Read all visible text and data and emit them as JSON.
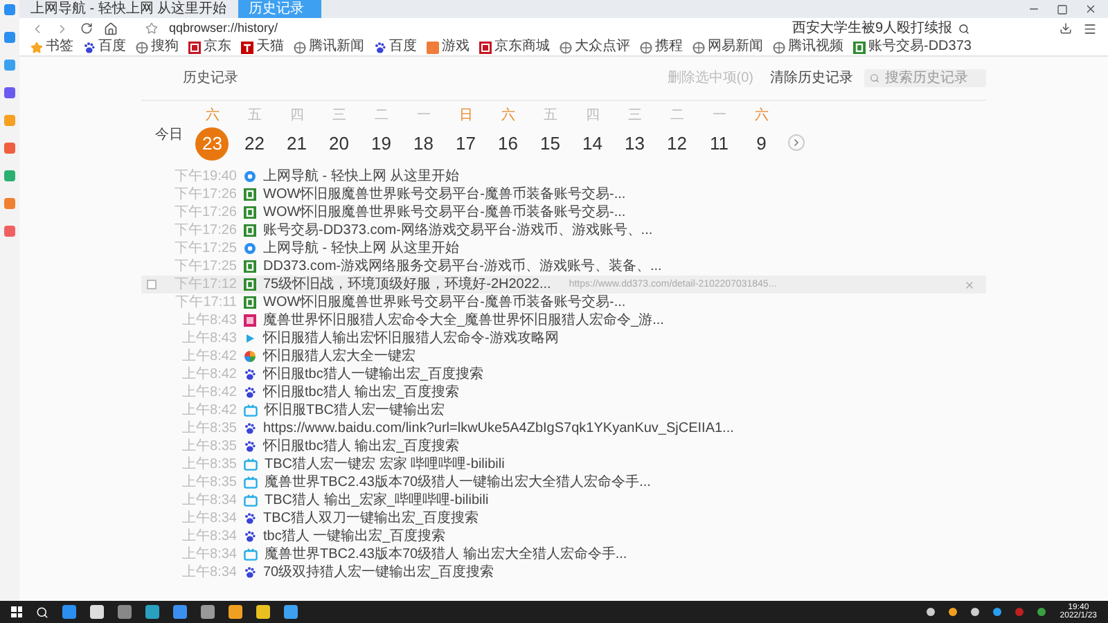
{
  "tabs": [
    {
      "title": "上网导航 - 轻快上网 从这里开始",
      "selected": false
    },
    {
      "title": "历史记录",
      "selected": true
    }
  ],
  "address": "qqbrowser://history/",
  "toolbar_search": "西安大学生被9人殴打续报",
  "bookmarks": [
    {
      "label": "书签",
      "kind": "star"
    },
    {
      "label": "百度",
      "kind": "paw"
    },
    {
      "label": "搜狗",
      "kind": "globe"
    },
    {
      "label": "京东",
      "kind": "jd"
    },
    {
      "label": "天猫",
      "kind": "tmall"
    },
    {
      "label": "腾讯新闻",
      "kind": "globe"
    },
    {
      "label": "百度",
      "kind": "paw"
    },
    {
      "label": "游戏",
      "kind": "game"
    },
    {
      "label": "京东商城",
      "kind": "jd"
    },
    {
      "label": "大众点评",
      "kind": "globe"
    },
    {
      "label": "携程",
      "kind": "globe"
    },
    {
      "label": "网易新闻",
      "kind": "globe"
    },
    {
      "label": "腾讯视频",
      "kind": "globe"
    },
    {
      "label": "账号交易-DD373",
      "kind": "d"
    }
  ],
  "header": {
    "title": "历史记录",
    "delete": "删除选中项(0)",
    "clear": "清除历史记录",
    "search_placeholder": "搜索历史记录"
  },
  "dates": {
    "today": "今日",
    "days": [
      {
        "weekday": "六",
        "day": "23",
        "weekend": true,
        "selected": true
      },
      {
        "weekday": "五",
        "day": "22",
        "weekend": false,
        "selected": false
      },
      {
        "weekday": "四",
        "day": "21",
        "weekend": false,
        "selected": false
      },
      {
        "weekday": "三",
        "day": "20",
        "weekend": false,
        "selected": false
      },
      {
        "weekday": "二",
        "day": "19",
        "weekend": false,
        "selected": false
      },
      {
        "weekday": "一",
        "day": "18",
        "weekend": false,
        "selected": false
      },
      {
        "weekday": "日",
        "day": "17",
        "weekend": true,
        "selected": false
      },
      {
        "weekday": "六",
        "day": "16",
        "weekend": true,
        "selected": false
      },
      {
        "weekday": "五",
        "day": "15",
        "weekend": false,
        "selected": false
      },
      {
        "weekday": "四",
        "day": "14",
        "weekend": false,
        "selected": false
      },
      {
        "weekday": "三",
        "day": "13",
        "weekend": false,
        "selected": false
      },
      {
        "weekday": "二",
        "day": "12",
        "weekend": false,
        "selected": false
      },
      {
        "weekday": "一",
        "day": "11",
        "weekend": false,
        "selected": false
      },
      {
        "weekday": "六",
        "day": "9",
        "weekend": true,
        "selected": false
      }
    ]
  },
  "history": [
    {
      "time": "下午19:40",
      "title": "上网导航 - 轻快上网 从这里开始",
      "kind": "ie",
      "hovered": false
    },
    {
      "time": "下午17:26",
      "title": "WOW怀旧服魔兽世界账号交易平台-魔兽币装备账号交易-...",
      "kind": "d",
      "hovered": false
    },
    {
      "time": "下午17:26",
      "title": "WOW怀旧服魔兽世界账号交易平台-魔兽币装备账号交易-...",
      "kind": "d",
      "hovered": false
    },
    {
      "time": "下午17:26",
      "title": "账号交易-DD373.com-网络游戏交易平台-游戏币、游戏账号、...",
      "kind": "d",
      "hovered": false
    },
    {
      "time": "下午17:25",
      "title": "上网导航 - 轻快上网 从这里开始",
      "kind": "ie",
      "hovered": false
    },
    {
      "time": "下午17:25",
      "title": "DD373.com-游戏网络服务交易平台-游戏币、游戏账号、装备、...",
      "kind": "d",
      "hovered": false
    },
    {
      "time": "下午17:12",
      "title": "75级怀旧战，环境顶级好服，环境好-2H2022...",
      "kind": "d",
      "hovered": true,
      "url": "https://www.dd373.com/detail-2102207031845..."
    },
    {
      "time": "下午17:11",
      "title": "WOW怀旧服魔兽世界账号交易平台-魔兽币装备账号交易-...",
      "kind": "d",
      "hovered": false
    },
    {
      "time": "上午8:43",
      "title": "魔兽世界怀旧服猎人宏命令大全_魔兽世界怀旧服猎人宏命令_游...",
      "kind": "ten",
      "hovered": false
    },
    {
      "time": "上午8:43",
      "title": "怀旧服猎人输出宏怀旧服猎人宏命令-游戏攻略网",
      "kind": "arrow",
      "hovered": false
    },
    {
      "time": "上午8:42",
      "title": "怀旧服猎人宏大全一键宏",
      "kind": "multi",
      "hovered": false
    },
    {
      "time": "上午8:42",
      "title": "怀旧服tbc猎人一键输出宏_百度搜索",
      "kind": "baidu",
      "hovered": false
    },
    {
      "time": "上午8:42",
      "title": "怀旧服tbc猎人 输出宏_百度搜索",
      "kind": "baidu",
      "hovered": false
    },
    {
      "time": "上午8:42",
      "title": "怀旧服TBC猎人宏一键输出宏",
      "kind": "bili",
      "hovered": false
    },
    {
      "time": "上午8:35",
      "title": "https://www.baidu.com/link?url=lkwUke5A4ZbIgS7qk1YKyanKuv_SjCEIIA1...",
      "kind": "baidu",
      "hovered": false
    },
    {
      "time": "上午8:35",
      "title": "怀旧服tbc猎人 输出宏_百度搜索",
      "kind": "baidu",
      "hovered": false
    },
    {
      "time": "上午8:35",
      "title": "TBC猎人宏一键宏 宏家 哔哩哔哩-bilibili",
      "kind": "bili",
      "hovered": false
    },
    {
      "time": "上午8:35",
      "title": "魔兽世界TBC2.43版本70级猎人一键输出宏大全猎人宏命令手...",
      "kind": "bili",
      "hovered": false
    },
    {
      "time": "上午8:34",
      "title": "TBC猎人 输出_宏家_哔哩哔哩-bilibili",
      "kind": "bili",
      "hovered": false
    },
    {
      "time": "上午8:34",
      "title": "TBC猎人双刀一键输出宏_百度搜索",
      "kind": "baidu",
      "hovered": false
    },
    {
      "time": "上午8:34",
      "title": "tbc猎人 一键输出宏_百度搜索",
      "kind": "baidu",
      "hovered": false
    },
    {
      "time": "上午8:34",
      "title": "魔兽世界TBC2.43版本70级猎人 输出宏大全猎人宏命令手...",
      "kind": "bili",
      "hovered": false
    },
    {
      "time": "上午8:34",
      "title": "70级双持猎人宏一键输出宏_百度搜索",
      "kind": "baidu",
      "hovered": false
    }
  ],
  "taskbar": {
    "time": "19:40",
    "date": "2022/1/23"
  }
}
